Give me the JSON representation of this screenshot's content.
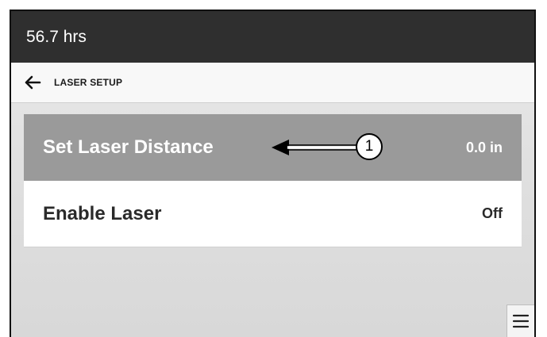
{
  "status_bar": {
    "hours": "56.7 hrs"
  },
  "header": {
    "back_icon": "arrow-left-icon",
    "title": "LASER SETUP"
  },
  "settings": [
    {
      "label": "Set Laser Distance",
      "value": "0.0 in",
      "selected": true
    },
    {
      "label": "Enable Laser",
      "value": "Off",
      "selected": false
    }
  ],
  "callout": {
    "number": "1",
    "icon": "callout-arrow-icon"
  },
  "menu_button": {
    "icon": "hamburger-menu-icon"
  },
  "colors": {
    "status_bar_bg": "#2f2f2f",
    "selected_row_bg": "#9a9a9a",
    "row_bg": "#ffffff",
    "header_bg": "#f8f8f8"
  }
}
